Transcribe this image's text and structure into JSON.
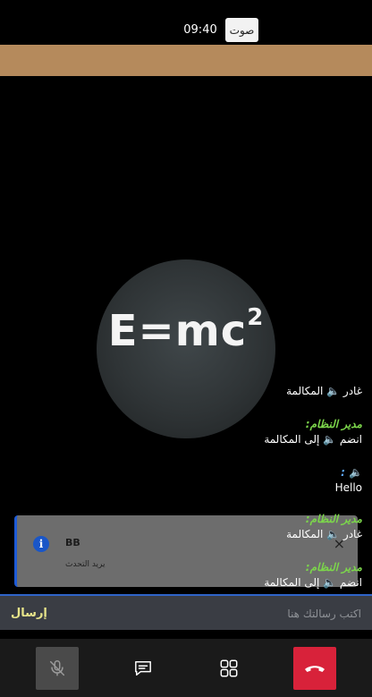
{
  "status": {
    "time": "09:40",
    "audio_label": "صوت"
  },
  "avatar": {
    "formula_base": "E=mc",
    "formula_exp": "2"
  },
  "chat": {
    "messages": [
      {
        "sender": "",
        "text": "غادر 🔈 المكالمة"
      },
      {
        "sender": "مدير النظام:",
        "text": "انضم 🔈 إلى المكالمة"
      },
      {
        "sender": "🔈 :",
        "text": "Hello"
      },
      {
        "sender": "مدير النظام:",
        "text": "غادر 🔈 المكالمة"
      },
      {
        "sender": "مدير النظام:",
        "text": "انضم 🔈 إلى المكالمة"
      }
    ]
  },
  "toast": {
    "title": "BB",
    "subtitle": "يريد التحدث",
    "icon": "info-icon",
    "close": "×"
  },
  "composer": {
    "placeholder": "اكتب رسالتك هنا",
    "send_label": "إرسال"
  },
  "toolbar": {
    "mic_icon": "microphone-muted-icon",
    "chat_icon": "chat-icon",
    "grid_icon": "grid-view-icon",
    "hangup_icon": "hang-up-icon"
  },
  "colors": {
    "banner": "#b58a5c",
    "sender": "#7cd64b",
    "hangup": "#d8223a",
    "accent": "#2f64c8",
    "send": "#e7e48a"
  }
}
